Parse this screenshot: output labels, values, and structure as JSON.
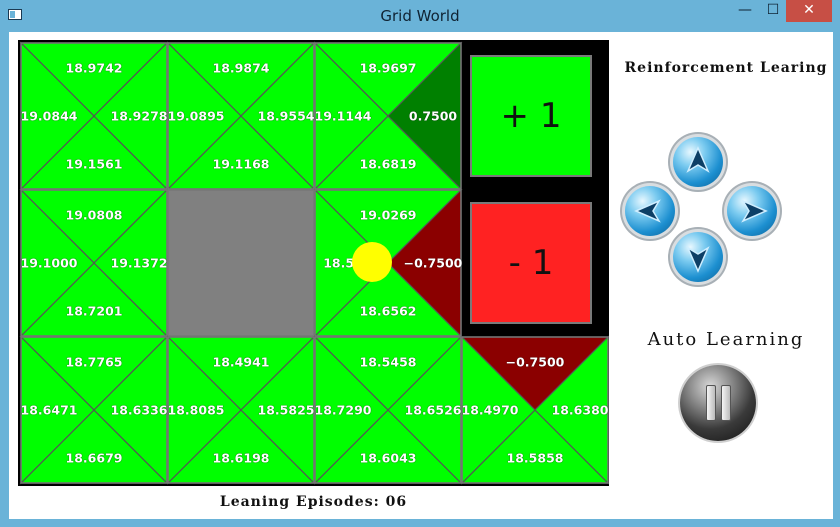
{
  "window": {
    "title": "Grid World",
    "min_glyph": "—",
    "max_glyph": "☐",
    "close_glyph": "✕"
  },
  "colors": {
    "titlebar": "#6ab3d8",
    "green": "#00ff00",
    "dark_green": "#008000",
    "dark_red": "#8b0000",
    "red": "#ff2222",
    "wall": "#808080",
    "agent": "#ffff00"
  },
  "grid": {
    "rows": [
      [
        {
          "type": "q",
          "q": {
            "up": "18.9742",
            "left": "19.0844",
            "right": "18.9278",
            "down": "19.1561"
          }
        },
        {
          "type": "q",
          "q": {
            "up": "18.9874",
            "left": "19.0895",
            "right": "18.9554",
            "down": "19.1168"
          }
        },
        {
          "type": "q",
          "q": {
            "up": "18.9697",
            "left": "19.1144",
            "right": "0.7500",
            "down": "18.6819"
          },
          "highlight": {
            "dir": "right",
            "color": "dark_green"
          }
        },
        {
          "type": "terminal",
          "label": "+ 1",
          "fill": "green"
        }
      ],
      [
        {
          "type": "q",
          "q": {
            "up": "19.0808",
            "left": "19.1000",
            "right": "19.1372",
            "down": "18.7201"
          }
        },
        {
          "type": "wall"
        },
        {
          "type": "q",
          "q": {
            "up": "19.0269",
            "left": "18.52",
            "right": "−0.7500",
            "down": "18.6562"
          },
          "highlight": {
            "dir": "right",
            "color": "dark_red"
          },
          "agent": true
        },
        {
          "type": "terminal",
          "label": "- 1",
          "fill": "red"
        }
      ],
      [
        {
          "type": "q",
          "q": {
            "up": "18.7765",
            "left": "18.6471",
            "right": "18.6336",
            "down": "18.6679"
          }
        },
        {
          "type": "q",
          "q": {
            "up": "18.4941",
            "left": "18.8085",
            "right": "18.5825",
            "down": "18.6198"
          }
        },
        {
          "type": "q",
          "q": {
            "up": "18.5458",
            "left": "18.7290",
            "right": "18.6526",
            "down": "18.6043"
          }
        },
        {
          "type": "q",
          "q": {
            "up": "−0.7500",
            "left": "18.4970",
            "right": "18.6380",
            "down": "18.5858"
          },
          "highlight": {
            "dir": "up",
            "color": "dark_red"
          }
        }
      ]
    ]
  },
  "side": {
    "title": "Reinforcement Learing",
    "arrows": [
      {
        "dir": "up",
        "icon": "arrow-up-icon"
      },
      {
        "dir": "left",
        "icon": "arrow-left-icon"
      },
      {
        "dir": "right",
        "icon": "arrow-right-icon"
      },
      {
        "dir": "down",
        "icon": "arrow-down-icon"
      }
    ],
    "auto_learning": "Auto Learning",
    "pause_icon": "pause-icon"
  },
  "footer": {
    "episodes": "Leaning Episodes: 06"
  }
}
